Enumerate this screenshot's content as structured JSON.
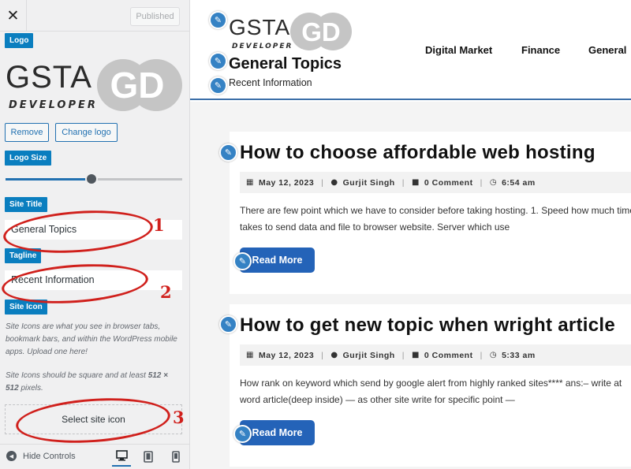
{
  "panel": {
    "close_glyph": "✕",
    "publish_label": "Published",
    "logo_section_label": "Logo",
    "logo": {
      "wordmark": "GSTA",
      "sub": "DEVELOPER",
      "mark": "GD"
    },
    "remove_label": "Remove",
    "change_logo_label": "Change logo",
    "logo_size_label": "Logo Size",
    "logo_size_fraction": 0.49,
    "site_title_label": "Site Title",
    "site_title_value": "General Topics",
    "tagline_label": "Tagline",
    "tagline_value": "Recent Information",
    "site_icon_label": "Site Icon",
    "site_icon_desc1": "Site Icons are what you see in browser tabs, bookmark bars, and within the WordPress mobile apps. Upload one here!",
    "site_icon_desc2_pre": "Site Icons should be square and at least ",
    "site_icon_desc2_dim": "512 × 512",
    "site_icon_desc2_post": " pixels.",
    "select_icon_label": "Select site icon",
    "hide_controls_label": "Hide Controls"
  },
  "annotations": {
    "n1": "1",
    "n2": "2",
    "n3": "3",
    "color": "#d0201c"
  },
  "preview": {
    "logo": {
      "wordmark": "GSTA",
      "sub": "DEVELOPER",
      "mark": "GD"
    },
    "site_title": "General Topics",
    "tagline": "Recent Information",
    "nav": [
      "Digital Market",
      "Finance",
      "General"
    ],
    "posts": [
      {
        "title": "How to choose affordable web hosting",
        "date": "May 12, 2023",
        "author": "Gurjit Singh",
        "comments": "0 Comment",
        "time": "6:54 am",
        "excerpt_line1": "There are few point which we have to consider before taking hosting. 1. Speed how much time",
        "excerpt_line2": "takes to send data and file to browser website. Server which use",
        "read_more": "Read More"
      },
      {
        "title": "How to get new topic when wright article",
        "date": "May 12, 2023",
        "author": "Gurjit Singh",
        "comments": "0 Comment",
        "time": "5:33 am",
        "excerpt_line1": "How rank on keyword which send by google alert from highly ranked sites**** ans:– write at",
        "excerpt_line2": "word article(deep inside) — as other site write for specific point —",
        "read_more": "Read More"
      }
    ]
  },
  "colors": {
    "accent": "#2271b1",
    "section_label": "#0a7ebf",
    "edit_pencil": "#3582c4",
    "read_more": "#2463b8",
    "header_rule": "#3c6fa8"
  },
  "icons": [
    "close-icon",
    "pencil-icon",
    "calendar-icon",
    "user-icon",
    "comments-icon",
    "clock-icon",
    "desktop-icon",
    "tablet-icon",
    "mobile-icon",
    "arrow-left-icon"
  ]
}
